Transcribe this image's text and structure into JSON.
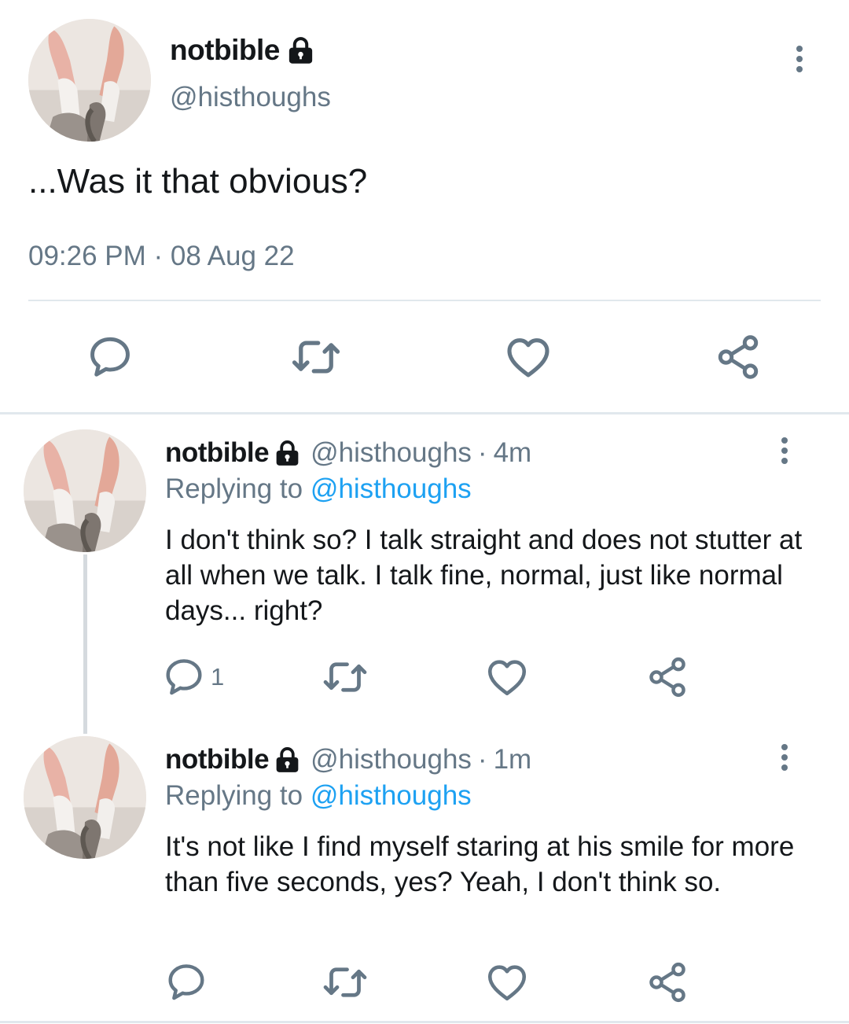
{
  "main_tweet": {
    "display_name": "notbible",
    "handle": "@histhoughs",
    "text": "...Was it that obvious?",
    "timestamp": "09:26 PM · 08 Aug 22"
  },
  "replies": [
    {
      "display_name": "notbible",
      "handle": "@histhoughs",
      "age": "4m",
      "replying_to_label": "Replying to",
      "replying_to_handle": "@histhoughs",
      "text": "I don't think so? I talk straight and does not stutter at all when we talk. I talk fine, normal, just like normal days... right?",
      "reply_count": "1"
    },
    {
      "display_name": "notbible",
      "handle": "@histhoughs",
      "age": "1m",
      "replying_to_label": "Replying to",
      "replying_to_handle": "@histhoughs",
      "text": "It's not like I find myself staring at his smile for more than five seconds, yes? Yeah, I don't think so.",
      "reply_count": ""
    }
  ],
  "separator": "·",
  "icons": [
    "lock-icon",
    "more-options-icon",
    "reply-icon",
    "retweet-icon",
    "like-icon",
    "share-icon"
  ],
  "colors": {
    "text": "#14171a",
    "muted": "#657786",
    "link": "#1da1f2",
    "divider": "#e1e8ed"
  }
}
